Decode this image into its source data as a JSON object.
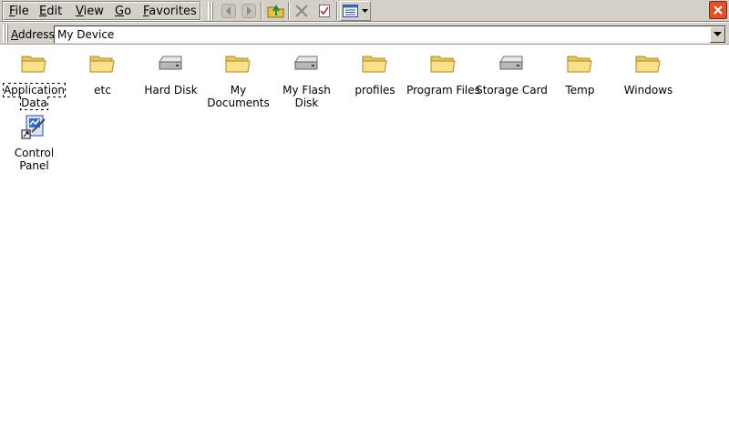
{
  "menu": {
    "file": {
      "ul": "F",
      "rest": "ile"
    },
    "edit": {
      "ul": "E",
      "rest": "dit"
    },
    "view": {
      "ul": "V",
      "rest": "iew"
    },
    "go": {
      "ul": "G",
      "rest": "o"
    },
    "favorites": {
      "ul": "F",
      "rest": "avorites"
    }
  },
  "toolbar": {
    "icons": [
      "back-icon",
      "forward-icon",
      "up-folder-icon",
      "delete-icon",
      "properties-icon",
      "views-icon",
      "dropdown-icon"
    ]
  },
  "address": {
    "label_ul": "A",
    "label_rest": "ddress",
    "value": "My Device"
  },
  "items": [
    {
      "label": "Application Data",
      "icon": "folder-icon",
      "selected": true
    },
    {
      "label": "etc",
      "icon": "folder-icon"
    },
    {
      "label": "Hard Disk",
      "icon": "drive-icon"
    },
    {
      "label": "My Documents",
      "icon": "folder-icon"
    },
    {
      "label": "My Flash Disk",
      "icon": "drive-icon"
    },
    {
      "label": "profiles",
      "icon": "folder-icon"
    },
    {
      "label": "Program Files",
      "icon": "folder-icon"
    },
    {
      "label": "Storage Card",
      "icon": "drive-icon"
    },
    {
      "label": "Temp",
      "icon": "folder-icon"
    },
    {
      "label": "Windows",
      "icon": "folder-icon"
    },
    {
      "label": "Control Panel",
      "icon": "control-panel-icon"
    }
  ],
  "colors": {
    "chrome": "#d4d0c8",
    "close": "#e0502c",
    "folder": "#f7d86a"
  }
}
